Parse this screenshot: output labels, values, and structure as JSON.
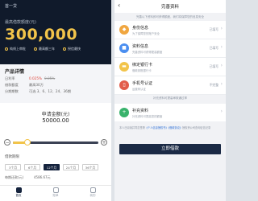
{
  "left": {
    "header_title": "首一贷",
    "hero": {
      "label": "最高借款额度(元)",
      "amount": "300,000",
      "tags": [
        "纯线上审批",
        "最高额三年",
        "授信最快"
      ]
    },
    "product": {
      "title": "产品详情",
      "rate_label": "日利率",
      "rate_value": "0.025%",
      "rate_old": "0.05%",
      "amount_label": "借款额度",
      "amount_value": "最高30万",
      "term_label": "分期期数",
      "term_value": "可选 3、6、12、24、36期"
    },
    "apply": {
      "label": "申请金额(元)",
      "value": "50000.00",
      "progress": 0.17
    },
    "term": {
      "label": "借款期限",
      "options": [
        "3个月",
        "6个月",
        "12个月",
        "24个月",
        "36个月"
      ],
      "selected_index": 2,
      "repay_label": "每期还款(元)",
      "repay_value": "4586.67元"
    },
    "tabbar": [
      {
        "label": "首页",
        "icon": "home-icon",
        "active": true
      },
      {
        "label": "账单",
        "icon": "bill-icon",
        "active": false
      },
      {
        "label": "我的",
        "icon": "user-icon",
        "active": false
      }
    ]
  },
  "right": {
    "title": "完善资料",
    "notice": "完善以下资料即可获得额度，我们将保障您的信息安全",
    "items": [
      {
        "name": "身份信息",
        "desc": "为了保障您的账户安全",
        "status": "已填写",
        "color": "#f0a640",
        "icon": "id-card-icon",
        "glyph": "◆"
      },
      {
        "name": "资料信息",
        "desc": "完善资料可获得更高额度",
        "status": "已填写",
        "color": "#4a8ef0",
        "icon": "document-icon",
        "glyph": "■"
      },
      {
        "name": "绑定银行卡",
        "desc": "借款到账银行卡",
        "status": "已填写",
        "color": "#f2c44a",
        "icon": "bank-card-icon",
        "glyph": "▬"
      },
      {
        "name": "手机号认证",
        "desc": "运营商认证",
        "status": "不完整",
        "color": "#e25c4a",
        "icon": "phone-icon",
        "glyph": "▯"
      }
    ],
    "supplement_label": "补充资料可提高审核通过率",
    "supplement": {
      "name": "补充资料",
      "desc": "补充资料可提高您的额度",
      "color": "#38b26b",
      "icon": "plus-icon",
      "glyph": "+"
    },
    "agreement_prefix": "本人已阅读并同意签署",
    "agreement_link_1": "《个人信息授权书》",
    "agreement_link_2": "《借款协议》",
    "agreement_suffix": "授权贵公司查询征信记录",
    "cta_label": "立即借款"
  }
}
